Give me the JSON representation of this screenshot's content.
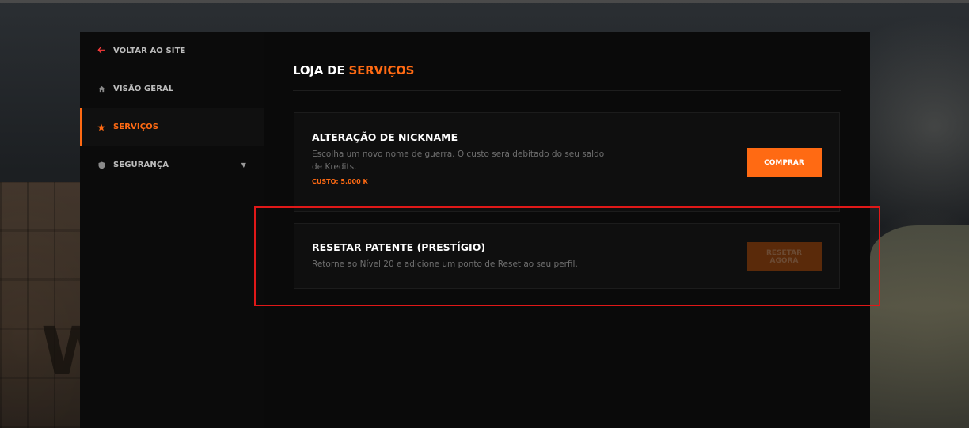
{
  "sidebar": {
    "items": [
      {
        "label": "VOLTAR AO SITE",
        "icon": "arrow-left-icon"
      },
      {
        "label": "VISÃO GERAL",
        "icon": "home-icon"
      },
      {
        "label": "SERVIÇOS",
        "icon": "star-icon",
        "active": true
      },
      {
        "label": "SEGURANÇA",
        "icon": "shield-icon",
        "has_submenu": true
      }
    ]
  },
  "main": {
    "title_part1": "LOJA DE",
    "title_part2": "SERVIÇOS",
    "services": [
      {
        "title": "ALTERAÇÃO DE NICKNAME",
        "description": "Escolha um novo nome de guerra. O custo será debitado do seu saldo de Kredits.",
        "cost": "CUSTO: 5.000 K",
        "button": "COMPRAR",
        "button_enabled": true
      },
      {
        "title": "RESETAR PATENTE (PRESTÍGIO)",
        "description": "Retorne ao Nível 20 e adicione um ponto de Reset ao seu perfil.",
        "button": "RESETAR AGORA",
        "button_enabled": false
      }
    ]
  },
  "colors": {
    "accent": "#ff6a13",
    "highlight_box": "#e01818",
    "panel_bg": "#0a0a0a"
  }
}
